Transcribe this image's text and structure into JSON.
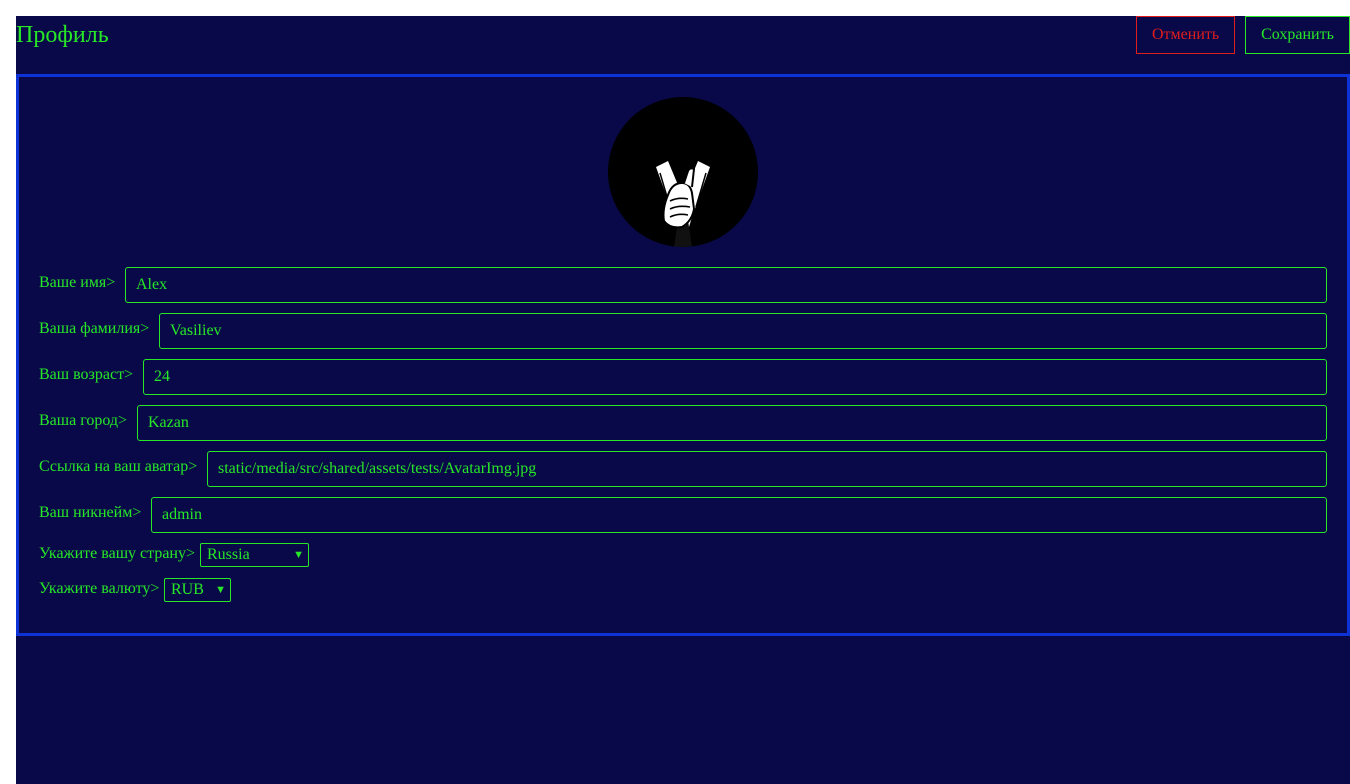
{
  "header": {
    "title": "Профиль",
    "cancel_label": "Отменить",
    "save_label": "Сохранить"
  },
  "avatar": {
    "icon": "anonymous-suit-avatar-icon"
  },
  "form": {
    "first_name": {
      "label": "Ваше имя>",
      "value": "Alex"
    },
    "last_name": {
      "label": "Ваша фамилия>",
      "value": "Vasiliev"
    },
    "age": {
      "label": "Ваш возраст>",
      "value": "24"
    },
    "city": {
      "label": "Ваша город>",
      "value": "Kazan"
    },
    "avatar_url": {
      "label": "Ссылка на ваш аватар>",
      "value": "static/media/src/shared/assets/tests/AvatarImg.jpg"
    },
    "nickname": {
      "label": "Ваш никнейм>",
      "value": "admin"
    },
    "country": {
      "label": "Укажите вашу страну>",
      "selected": "Russia"
    },
    "currency": {
      "label": "Укажите валюту>",
      "selected": "RUB"
    }
  },
  "colors": {
    "background": "#090949",
    "accent": "#27e827",
    "danger": "#e01d1d",
    "card_border": "#0d32d6"
  }
}
